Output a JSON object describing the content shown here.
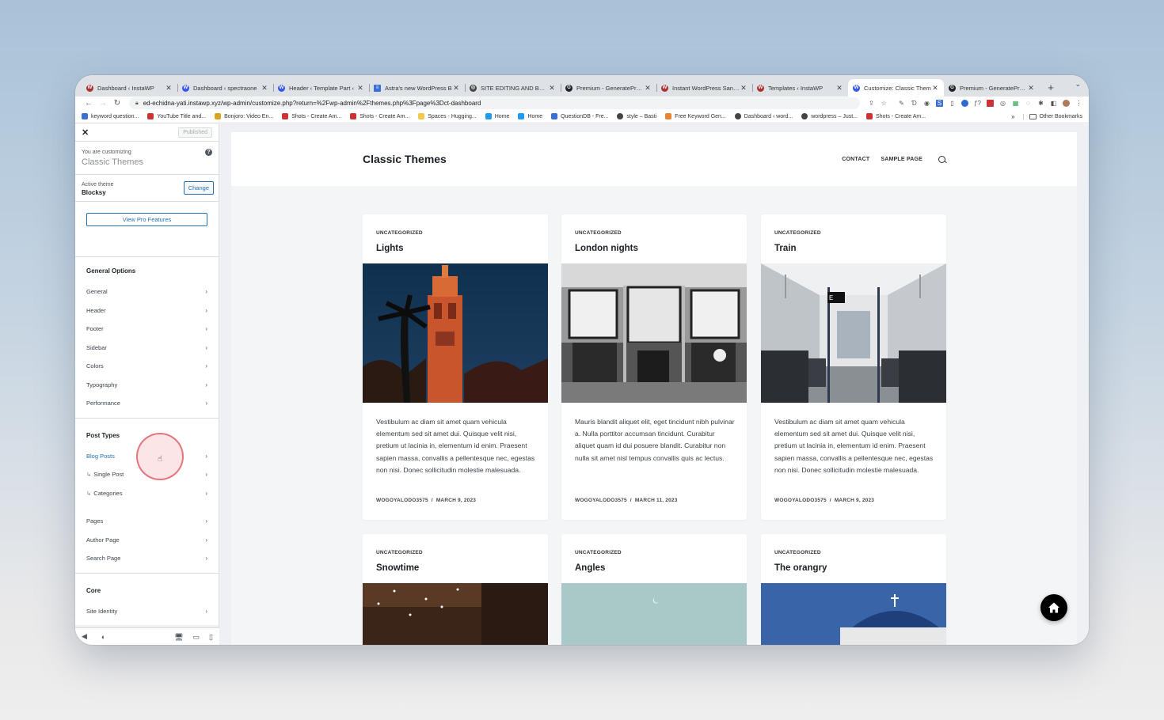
{
  "browser": {
    "tabs": [
      {
        "title": "Dashboard ‹ InstaWP",
        "fav_color": "#a33",
        "fav_glyph": "W"
      },
      {
        "title": "Dashboard ‹ spectraone",
        "fav_color": "#3858e9",
        "fav_glyph": "W"
      },
      {
        "title": "Header ‹ Template Part ‹",
        "fav_color": "#3858e9",
        "fav_glyph": "W"
      },
      {
        "title": "Astra's new WordPress B",
        "fav_color": "#3b6fd6",
        "fav_glyph": "≡"
      },
      {
        "title": "SITE EDITING AND BLOCK",
        "fav_color": "#444",
        "fav_glyph": "◎"
      },
      {
        "title": "Premium - GeneratePress",
        "fav_color": "#222",
        "fav_glyph": "G"
      },
      {
        "title": "Instant WordPress Sandb",
        "fav_color": "#a33",
        "fav_glyph": "W"
      },
      {
        "title": "Templates ‹ InstaWP",
        "fav_color": "#a33",
        "fav_glyph": "W"
      },
      {
        "title": "Customize: Classic Them",
        "fav_color": "#3858e9",
        "fav_glyph": "W",
        "active": true
      },
      {
        "title": "Premium - GeneratePress",
        "fav_color": "#222",
        "fav_glyph": "G"
      }
    ],
    "new_tab": "+",
    "tab_menu": "⌄",
    "url": "ed-echidna-yati.instawp.xyz/wp-admin/customize.php?return=%2Fwp-admin%2Fthemes.php%3Fpage%3Dct-dashboard",
    "bookmarks": [
      {
        "label": "keyword question...",
        "color": "#3b6fd6"
      },
      {
        "label": "YouTube Title and...",
        "color": "#c33"
      },
      {
        "label": "Bonjoro: Video En...",
        "color": "#d9a521"
      },
      {
        "label": "Shots - Create Am...",
        "color": "#c33"
      },
      {
        "label": "Shots - Create Am...",
        "color": "#c33"
      },
      {
        "label": "Spaces - Hugging...",
        "color": "#f2c94c"
      },
      {
        "label": "Home",
        "color": "#1d9bf0"
      },
      {
        "label": "Home",
        "color": "#1d9bf0"
      },
      {
        "label": "QuestionDB - Fre...",
        "color": "#3b6fd6"
      },
      {
        "label": "style – Basti",
        "color": "#444"
      },
      {
        "label": "Free Keyword Gen...",
        "color": "#e6862e"
      },
      {
        "label": "Dashboard ‹ word...",
        "color": "#444"
      },
      {
        "label": "wordpress – Just...",
        "color": "#444"
      },
      {
        "label": "Shots - Create Am...",
        "color": "#c33"
      }
    ],
    "bookmarks_more": "»",
    "other_bookmarks": "Other Bookmarks"
  },
  "customizer": {
    "close": "✕",
    "published": "Published",
    "customizing_label": "You are customizing",
    "customizing_title": "Classic Themes",
    "help": "?",
    "active_theme_label": "Active theme",
    "active_theme_name": "Blocksy",
    "change_button": "Change",
    "pro_button": "View Pro Features",
    "sections": [
      {
        "title": "General Options",
        "items": [
          "General",
          "Header",
          "Footer",
          "Sidebar",
          "Colors",
          "Typography",
          "Performance"
        ]
      },
      {
        "title": "Post Types",
        "items": [
          "Blog Posts",
          "Single Post",
          "Categories",
          "Pages",
          "Author Page",
          "Search Page"
        ]
      },
      {
        "title": "Core",
        "items": [
          "Site Identity"
        ]
      }
    ],
    "selected_item": "Blog Posts",
    "sub_prefix": "↳"
  },
  "site": {
    "title": "Classic Themes",
    "nav": [
      "CONTACT",
      "SAMPLE PAGE"
    ],
    "posts": [
      {
        "category": "UNCATEGORIZED",
        "title": "Lights",
        "excerpt": "Vestibulum ac diam sit amet quam vehicula elementum sed sit amet dui. Quisque velit nisi, pretium ut lacinia in, elementum id enim. Praesent sapien massa, convallis a pellentesque nec, egestas non nisi. Donec sollicitudin molestie malesuada.",
        "author": "WOGOYALODO3575",
        "date": "MARCH 9, 2023"
      },
      {
        "category": "UNCATEGORIZED",
        "title": "London nights",
        "excerpt": "Mauris blandit aliquet elit, eget tincidunt nibh pulvinar a. Nulla porttitor accumsan tincidunt. Curabitur aliquet quam id dui posuere blandit. Curabitur non nulla sit amet nisl tempus convallis quis ac lectus.",
        "author": "WOGOYALODO3575",
        "date": "MARCH 11, 2023"
      },
      {
        "category": "UNCATEGORIZED",
        "title": "Train",
        "excerpt": "Vestibulum ac diam sit amet quam vehicula elementum sed sit amet dui. Quisque velit nisi, pretium ut lacinia in, elementum id enim. Praesent sapien massa, convallis a pellentesque nec, egestas non nisi. Donec sollicitudin molestie malesuada.",
        "author": "WOGOYALODO3575",
        "date": "MARCH 9, 2023"
      },
      {
        "category": "UNCATEGORIZED",
        "title": "Snowtime"
      },
      {
        "category": "UNCATEGORIZED",
        "title": "Angles"
      },
      {
        "category": "UNCATEGORIZED",
        "title": "The orangry"
      }
    ]
  }
}
